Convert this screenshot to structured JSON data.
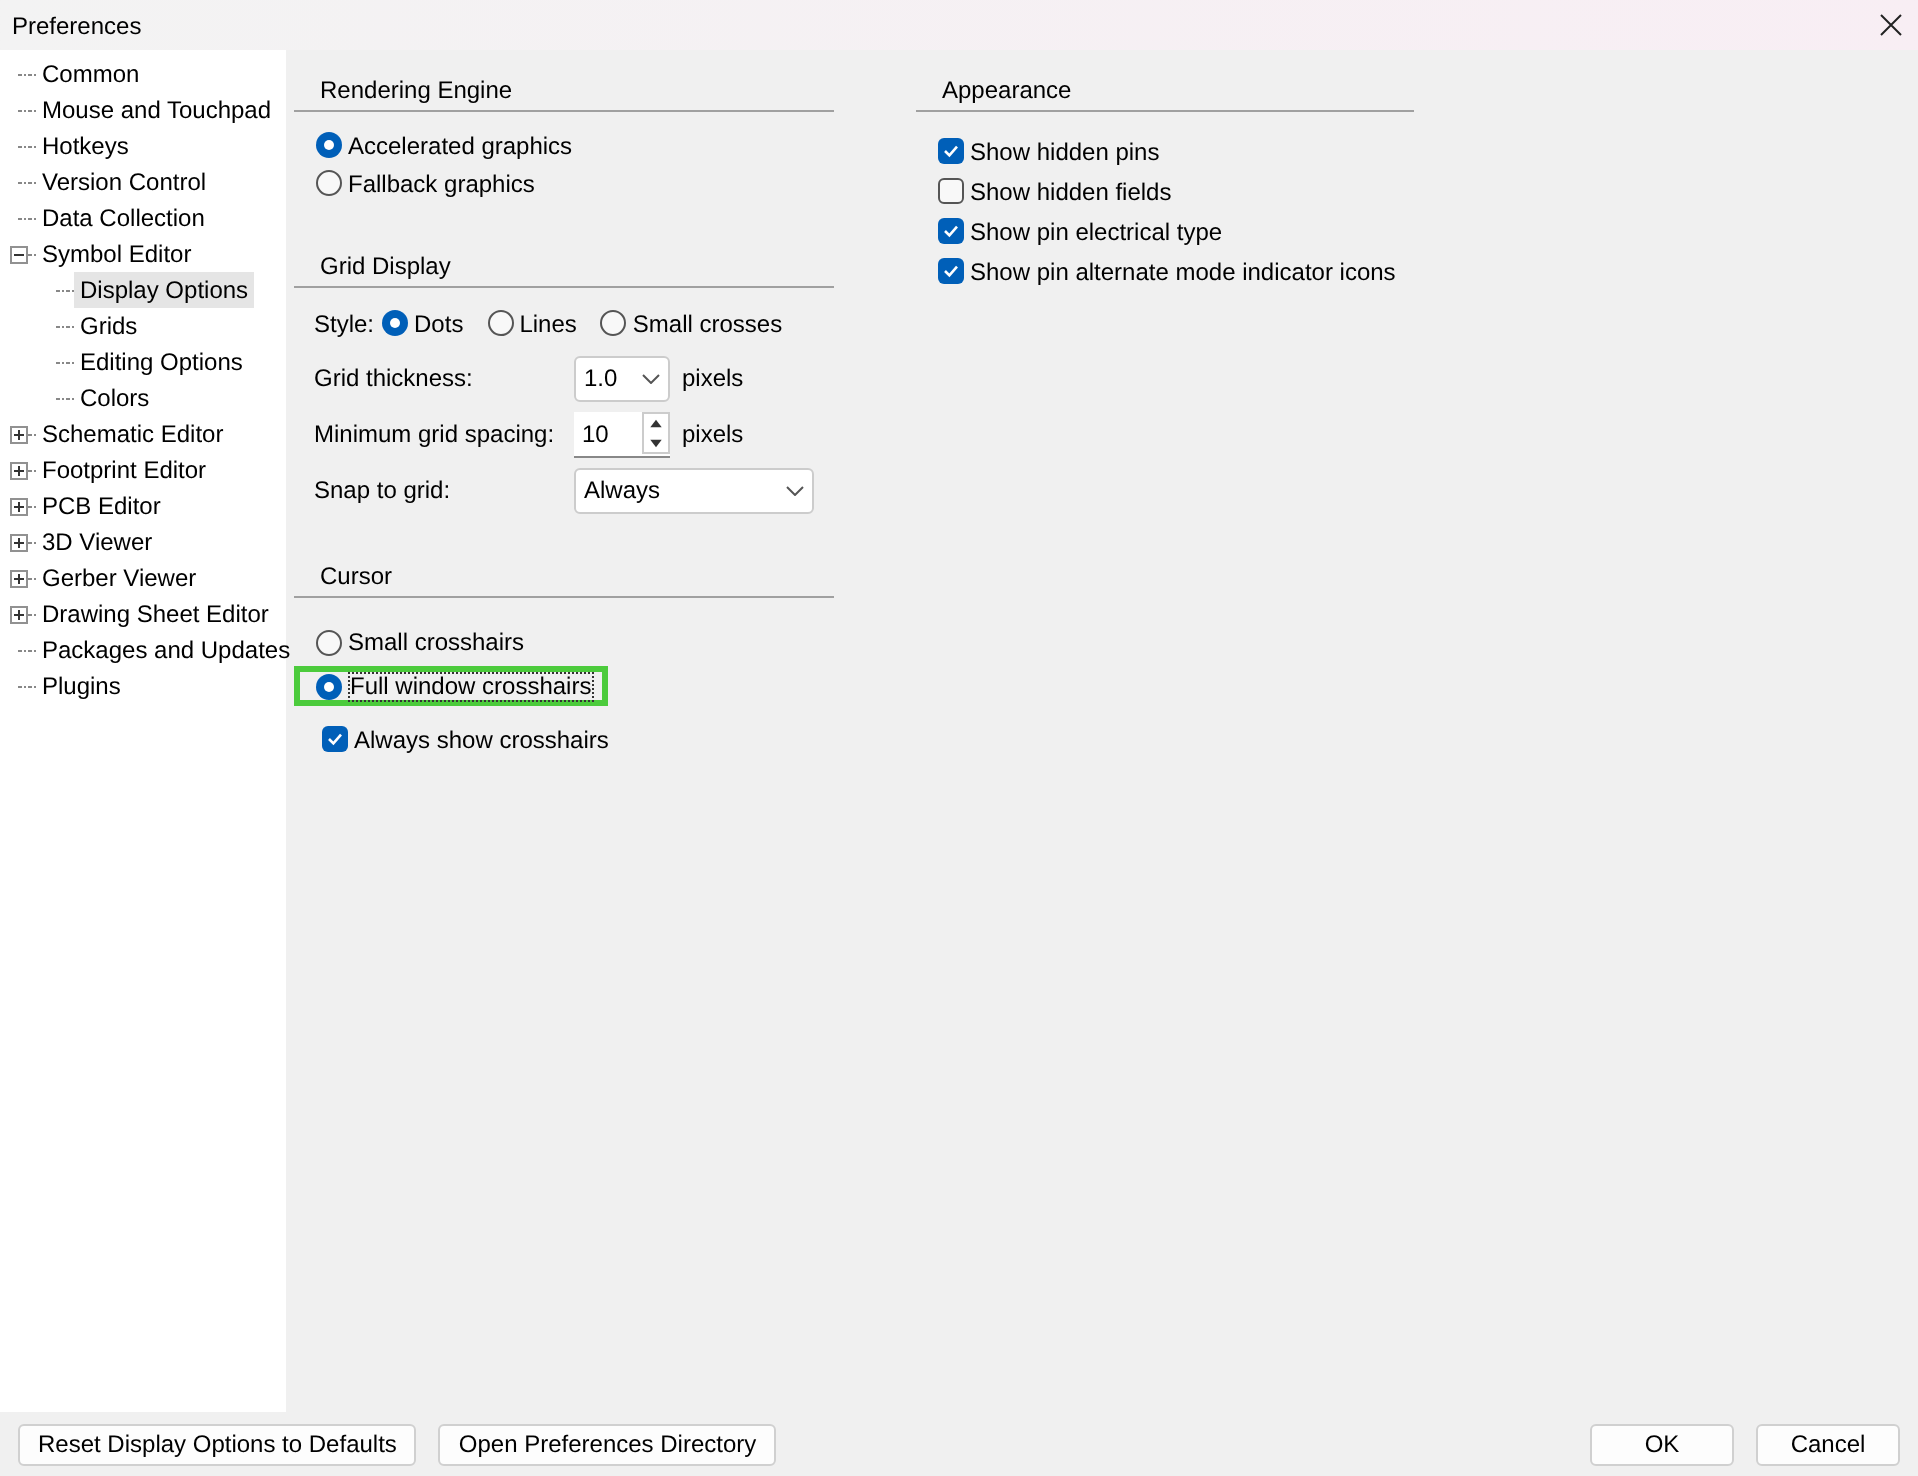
{
  "window": {
    "title": "Preferences"
  },
  "tree": [
    {
      "label": "Common",
      "selected": false
    },
    {
      "label": "Mouse and Touchpad",
      "selected": false
    },
    {
      "label": "Hotkeys",
      "selected": false
    },
    {
      "label": "Version Control",
      "selected": false
    },
    {
      "label": "Data Collection",
      "selected": false
    },
    {
      "label": "Symbol Editor",
      "selected": false,
      "expanded": true,
      "children": [
        {
          "label": "Display Options",
          "selected": true
        },
        {
          "label": "Grids",
          "selected": false
        },
        {
          "label": "Editing Options",
          "selected": false
        },
        {
          "label": "Colors",
          "selected": false
        }
      ]
    },
    {
      "label": "Schematic Editor",
      "selected": false,
      "expanded": false
    },
    {
      "label": "Footprint Editor",
      "selected": false,
      "expanded": false
    },
    {
      "label": "PCB Editor",
      "selected": false,
      "expanded": false
    },
    {
      "label": "3D Viewer",
      "selected": false,
      "expanded": false
    },
    {
      "label": "Gerber Viewer",
      "selected": false,
      "expanded": false
    },
    {
      "label": "Drawing Sheet Editor",
      "selected": false,
      "expanded": false
    },
    {
      "label": "Packages and Updates",
      "selected": false
    },
    {
      "label": "Plugins",
      "selected": false
    }
  ],
  "rendering_engine": {
    "title": "Rendering Engine",
    "options": [
      {
        "label": "Accelerated graphics",
        "selected": true
      },
      {
        "label": "Fallback graphics",
        "selected": false
      }
    ]
  },
  "grid_display": {
    "title": "Grid Display",
    "style_label": "Style:",
    "styles": [
      {
        "label": "Dots",
        "selected": true
      },
      {
        "label": "Lines",
        "selected": false
      },
      {
        "label": "Small crosses",
        "selected": false
      }
    ],
    "fields": [
      {
        "kind": "dropdown",
        "label": "Grid thickness:",
        "value": "1.0",
        "unit": "pixels"
      },
      {
        "kind": "spinner",
        "label": "Minimum grid spacing:",
        "value": "10",
        "unit": "pixels"
      },
      {
        "kind": "wide-dropdown",
        "label": "Snap to grid:",
        "value": "Always"
      }
    ]
  },
  "cursor": {
    "title": "Cursor",
    "options": [
      {
        "label": "Small crosshairs",
        "selected": false,
        "focused": false
      },
      {
        "label": "Full window crosshairs",
        "selected": true,
        "focused": true
      }
    ],
    "always_show": {
      "label": "Always show crosshairs",
      "checked": true
    }
  },
  "appearance": {
    "title": "Appearance",
    "options": [
      {
        "label": "Show hidden pins",
        "checked": true
      },
      {
        "label": "Show hidden fields",
        "checked": false
      },
      {
        "label": "Show pin electrical type",
        "checked": true
      },
      {
        "label": "Show pin alternate mode indicator icons",
        "checked": true
      }
    ]
  },
  "buttons_left": [
    "Reset Display Options to Defaults",
    "Open Preferences Directory"
  ],
  "buttons_right": [
    "OK",
    "Cancel"
  ]
}
